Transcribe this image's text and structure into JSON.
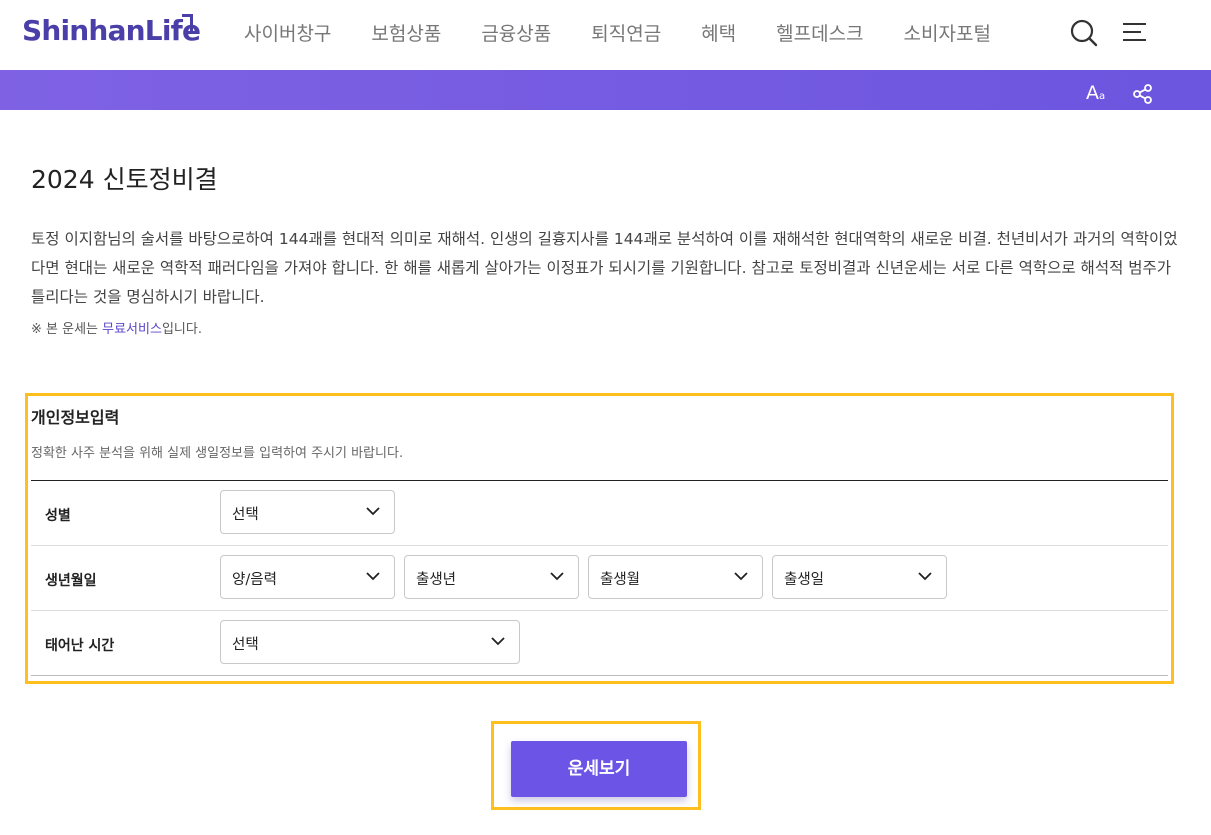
{
  "header": {
    "logo_text": "ShinhanLife",
    "nav": [
      "사이버창구",
      "보험상품",
      "금융상품",
      "퇴직연금",
      "혜택",
      "헬프데스크",
      "소비자포털"
    ],
    "search_icon": "search-icon",
    "menu_icon": "hamburger-menu-icon"
  },
  "subbar": {
    "font_size_label": "A",
    "font_size_small": "a",
    "share_icon": "share-icon",
    "colors": {
      "band_start": "#7f62e4",
      "band_end": "#6c55df"
    }
  },
  "page": {
    "title": "2024 신토정비결",
    "description": "토정 이지함님의 술서를 바탕으로하여 144괘를 현대적 의미로 재해석. 인생의 길흉지사를 144괘로 분석하여 이를 재해석한 현대역학의 새로운 비결. 천년비서가 과거의 역학이었다면 현대는 새로운 역학적 패러다임을 가져야 합니다. 한 해를 새롭게 살아가는 이정표가 되시기를 기원합니다. 참고로 토정비결과 신년운세는 서로 다른 역학으로 해석적 범주가 틀리다는 것을 명심하시기 바랍니다.",
    "note_prefix": "※ 본 운세는 ",
    "note_link": "무료서비스",
    "note_suffix": "입니다."
  },
  "form": {
    "title": "개인정보입력",
    "subtitle": "정확한 사주 분석을 위해 실제 생일정보를 입력하여 주시기 바랍니다.",
    "rows": [
      {
        "label": "성별",
        "selects": [
          "선택"
        ]
      },
      {
        "label": "생년월일",
        "selects": [
          "양/음력",
          "출생년",
          "출생월",
          "출생일"
        ]
      },
      {
        "label": "태어난 시간",
        "selects": [
          "선택"
        ]
      }
    ]
  },
  "submit": {
    "label": "운세보기",
    "color": "#6c55e6"
  },
  "highlight_color": "#ffbf1f"
}
